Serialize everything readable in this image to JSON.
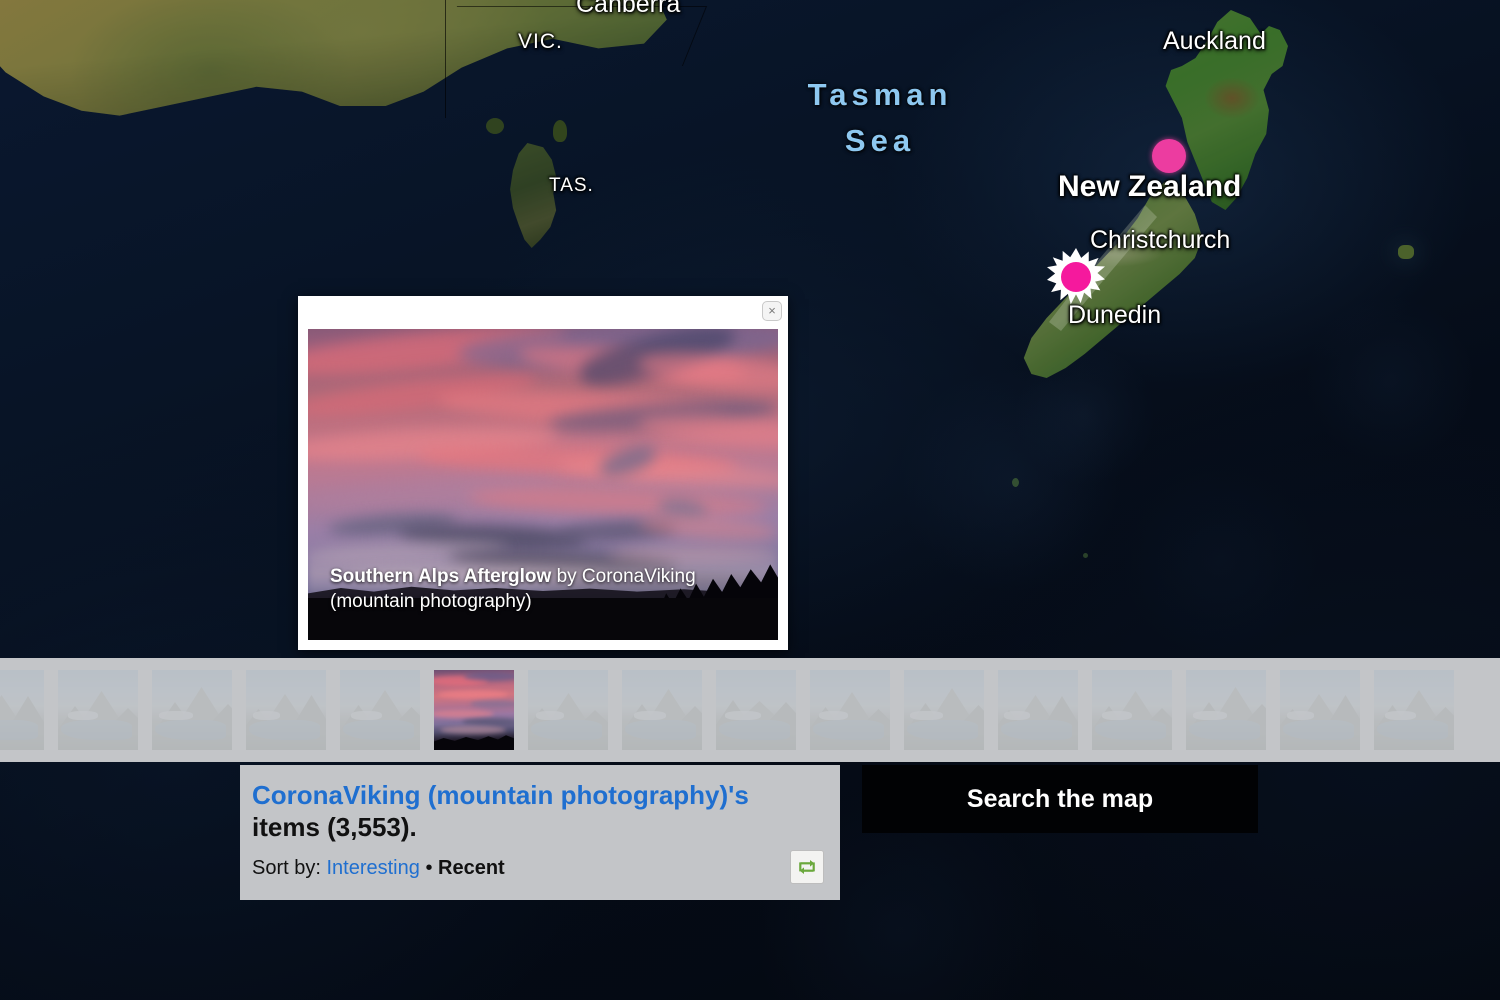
{
  "map": {
    "labels": [
      {
        "id": "canberra",
        "text": "Canberra",
        "type": "city"
      },
      {
        "id": "vic",
        "text": "VIC.",
        "type": "state"
      },
      {
        "id": "tas",
        "text": "TAS.",
        "type": "state"
      },
      {
        "id": "tasman_sea",
        "text": "Tasman Sea",
        "type": "sea",
        "color": "#8ec8f0"
      },
      {
        "id": "auckland",
        "text": "Auckland",
        "type": "city"
      },
      {
        "id": "new_zealand",
        "text": "New Zealand",
        "type": "country"
      },
      {
        "id": "christchurch",
        "text": "Christchurch",
        "type": "city"
      },
      {
        "id": "dunedin",
        "text": "Dunedin",
        "type": "city"
      }
    ],
    "label_text": {
      "canberra": "Canberra",
      "vic": "VIC.",
      "tas": "TAS.",
      "tasman_sea_line1": "Tasman",
      "tasman_sea_line2": "Sea",
      "auckland": "Auckland",
      "new_zealand": "New Zealand",
      "christchurch": "Christchurch",
      "dunedin": "Dunedin"
    },
    "markers": {
      "plain": {
        "name": "photo-cluster-marker",
        "color": "#ec3ca0"
      },
      "selected": {
        "name": "selected-photo-marker",
        "color": "#f5199d",
        "halo_color": "#ffffff"
      }
    }
  },
  "popup": {
    "close_label": "×",
    "photo_title": "Southern Alps Afterglow",
    "byline": " by CoronaViking",
    "owner_group": "(mountain photography)"
  },
  "filmstrip": {
    "selected_index": 5,
    "thumbs": [
      {
        "alt": "mountain lake"
      },
      {
        "alt": "alpine fjord"
      },
      {
        "alt": "snow ridge"
      },
      {
        "alt": "glacier valley"
      },
      {
        "alt": "rocky peak"
      },
      {
        "alt": "sunset afterglow"
      },
      {
        "alt": "lake basin"
      },
      {
        "alt": "steep ridge"
      },
      {
        "alt": "blue lake"
      },
      {
        "alt": "sunlit lake"
      },
      {
        "alt": "cliff lake"
      },
      {
        "alt": "mountain reflection"
      },
      {
        "alt": "snowy peaks"
      },
      {
        "alt": "turquoise lake"
      },
      {
        "alt": "icefield"
      },
      {
        "alt": "alpine tarn"
      }
    ]
  },
  "info_panel": {
    "owner_link": "CoronaViking (mountain photography)'s",
    "items_text": "items (3,553).",
    "item_count": "3,553",
    "sort_label": "Sort by:",
    "sort_interesting": "Interesting",
    "sort_separator": "•",
    "sort_recent": "Recent",
    "active_sort": "Recent",
    "refresh_icon": "refresh-cycle-icon"
  },
  "search": {
    "label": "Search the map"
  },
  "colors": {
    "link": "#1f6fd0",
    "panel_bg": "#c3c5c8",
    "marker_pink": "#ec3ca0",
    "sea_label": "#8ec8f0",
    "map_bg": "#060b14"
  }
}
